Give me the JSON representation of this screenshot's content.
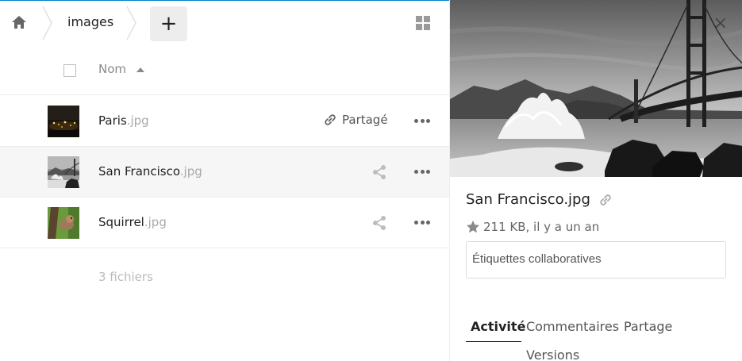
{
  "breadcrumb": {
    "home_icon": "home-icon",
    "current": "images"
  },
  "controls": {
    "add_label": "+",
    "view_toggle_icon": "grid-view-icon"
  },
  "file_list": {
    "column_name": "Nom",
    "sort_direction": "ascending",
    "files": [
      {
        "base": "Paris",
        "ext": ".jpg",
        "share_label": "Partagé",
        "share_state": "link"
      },
      {
        "base": "San Francisco",
        "ext": ".jpg",
        "share_label": "",
        "share_state": "none",
        "selected": true
      },
      {
        "base": "Squirrel",
        "ext": ".jpg",
        "share_label": "",
        "share_state": "none"
      }
    ],
    "summary": "3 fichiers"
  },
  "sidebar": {
    "close_label": "×",
    "file_title": "San Francisco.jpg",
    "meta": "211 KB, il y a un an",
    "tags_placeholder": "Étiquettes collaboratives",
    "tabs": [
      {
        "label": "Activité",
        "active": true
      },
      {
        "label": "Commentaires",
        "active": false
      },
      {
        "label": "Partage",
        "active": false
      },
      {
        "label": "Versions",
        "active": false
      }
    ]
  },
  "colors": {
    "accent": "#0082c9",
    "text": "#222222",
    "muted": "#a9a9a9",
    "selected_row": "#f6f6f6"
  }
}
